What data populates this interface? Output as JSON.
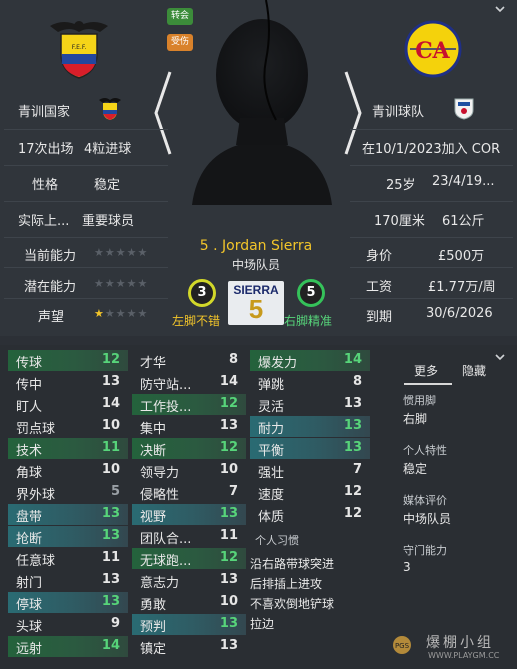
{
  "tags": {
    "transfer": "转会",
    "injury": "受伤"
  },
  "left_info": {
    "nation_label": "青训国家",
    "apps": "17次出场",
    "goals": "4粒进球",
    "personality_label": "性格",
    "personality_value": "稳定",
    "role_label": "实际上...",
    "role_value": "重要球员",
    "ca_label": "当前能力",
    "pa_label": "潜在能力",
    "rep_label": "声望",
    "ca_stars": 0,
    "pa_stars": 0,
    "rep_stars": 0.5
  },
  "right_info": {
    "club_label": "青训球队",
    "joined": "在10/1/2023加入 COR",
    "age": "25岁",
    "dob": "23/4/19...",
    "height": "170厘米",
    "weight": "61公斤",
    "value_label": "身价",
    "value": "£500万",
    "wage_label": "工资",
    "wage": "£1.77万/周",
    "expires_label": "到期",
    "expires": "30/6/2026"
  },
  "player": {
    "name": "5 . Jordan Sierra",
    "position": "中场队员",
    "shirt_name": "SIERRA",
    "shirt_number": "5",
    "left_foot_value": "3",
    "left_foot_label": "左脚不错",
    "right_foot_value": "5",
    "right_foot_label": "右脚精准"
  },
  "attributes": {
    "col1": [
      {
        "name": "传球",
        "value": "12",
        "hl": "green"
      },
      {
        "name": "传中",
        "value": "13",
        "hl": ""
      },
      {
        "name": "盯人",
        "value": "14",
        "hl": ""
      },
      {
        "name": "罚点球",
        "value": "10",
        "hl": ""
      },
      {
        "name": "技术",
        "value": "11",
        "hl": "green"
      },
      {
        "name": "角球",
        "value": "10",
        "hl": ""
      },
      {
        "name": "界外球",
        "value": "5",
        "hl": ""
      },
      {
        "name": "盘带",
        "value": "13",
        "hl": "teal"
      },
      {
        "name": "抢断",
        "value": "13",
        "hl": "teal"
      },
      {
        "name": "任意球",
        "value": "11",
        "hl": ""
      },
      {
        "name": "射门",
        "value": "13",
        "hl": ""
      },
      {
        "name": "停球",
        "value": "13",
        "hl": "teal"
      },
      {
        "name": "头球",
        "value": "9",
        "hl": ""
      },
      {
        "name": "远射",
        "value": "14",
        "hl": "green"
      }
    ],
    "col2": [
      {
        "name": "才华",
        "value": "8",
        "hl": ""
      },
      {
        "name": "防守站...",
        "value": "14",
        "hl": ""
      },
      {
        "name": "工作投...",
        "value": "12",
        "hl": "green"
      },
      {
        "name": "集中",
        "value": "13",
        "hl": ""
      },
      {
        "name": "决断",
        "value": "12",
        "hl": "green"
      },
      {
        "name": "领导力",
        "value": "10",
        "hl": ""
      },
      {
        "name": "侵略性",
        "value": "7",
        "hl": ""
      },
      {
        "name": "视野",
        "value": "13",
        "hl": "teal"
      },
      {
        "name": "团队合...",
        "value": "11",
        "hl": ""
      },
      {
        "name": "无球跑...",
        "value": "12",
        "hl": "green"
      },
      {
        "name": "意志力",
        "value": "13",
        "hl": ""
      },
      {
        "name": "勇敢",
        "value": "10",
        "hl": ""
      },
      {
        "name": "预判",
        "value": "13",
        "hl": "teal"
      },
      {
        "name": "镇定",
        "value": "13",
        "hl": ""
      }
    ],
    "col3": [
      {
        "name": "爆发力",
        "value": "14",
        "hl": "green"
      },
      {
        "name": "弹跳",
        "value": "8",
        "hl": ""
      },
      {
        "name": "灵活",
        "value": "13",
        "hl": ""
      },
      {
        "name": "耐力",
        "value": "13",
        "hl": "teal"
      },
      {
        "name": "平衡",
        "value": "13",
        "hl": "teal"
      },
      {
        "name": "强壮",
        "value": "7",
        "hl": ""
      },
      {
        "name": "速度",
        "value": "12",
        "hl": ""
      },
      {
        "name": "体质",
        "value": "12",
        "hl": ""
      }
    ],
    "habits_title": "个人习惯",
    "habits": [
      "沿右路带球突进",
      "后排插上进攻",
      "不喜欢倒地铲球",
      "拉边"
    ]
  },
  "side_panel": {
    "tab_more": "更多",
    "tab_hide": "隐藏",
    "pref_foot_label": "惯用脚",
    "pref_foot_value": "右脚",
    "trait_label": "个人特性",
    "trait_value": "稳定",
    "media_label": "媒体评价",
    "media_value": "中场队员",
    "gk_label": "守门能力",
    "gk_value": "3"
  },
  "watermark": {
    "text": "爆棚小组",
    "url": "WWW.PLAYGM.CC"
  },
  "colors": {
    "accent_green": "#57d47a",
    "accent_yellow": "#f2c52a",
    "bg": "#2c3036"
  }
}
